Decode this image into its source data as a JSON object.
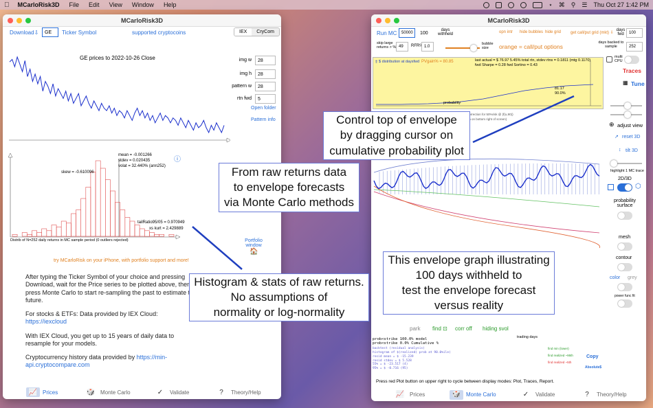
{
  "menubar": {
    "app": "MCarloRisk3D",
    "items": [
      "File",
      "Edit",
      "View",
      "Window",
      "Help"
    ],
    "clock": "Thu Oct 27  1:42 PM"
  },
  "left": {
    "title": "MCarloRisk3D",
    "download": "Download⇩",
    "ticker_value": "GE",
    "ticker_label": "Ticker Symbol",
    "supported": "supported cryptocoins",
    "seg": [
      "IEX",
      "CryCom"
    ],
    "chart_title": "GE prices to 2022-10-26 Close",
    "params": [
      {
        "label": "img w",
        "value": "28"
      },
      {
        "label": "img h",
        "value": "28"
      },
      {
        "label": "pattern w",
        "value": "28"
      },
      {
        "label": "rtn fwd",
        "value": "5"
      }
    ],
    "open_folder": "Open folder",
    "pattern_info": "Pattern info",
    "stats": {
      "mean": "mean = -0.001266",
      "stdev": "stdev = 0.020435",
      "volat": "volat = 32.440% (ann252)",
      "skew": "skew = -0.610096",
      "tail": "tailRatio95/05 = 0.970949",
      "kurt": "xs kurt = 2.429889"
    },
    "hist_caption": "Distrib of N=252 daily  returns in MC sample period (0 outliers rejected)",
    "portfolio": "Portfolio window",
    "promo": "try MCarloRisk on your iPhone, with portfolio support and more!",
    "para1": "After typing the Ticker Symbol of your choice and pressing Download, wait for the Price series to be plotted above, then press Monte Carlo to start re-sampling the past to estimate the future.",
    "para2a": "For stocks & ETFs:  Data provided by IEX Cloud:  ",
    "para2b": "https://iexcloud",
    "para3": "With IEX Cloud, you get up to 15 years of daily data to resample for your models.",
    "para4a": "Cryptocurrency history data provided by ",
    "para4b": "https://min-api.cryptocompare.com",
    "tabs": [
      "Prices",
      "Monte Carlo",
      "Validate",
      "Theory/Help"
    ]
  },
  "right": {
    "title": "MCarloRisk3D",
    "run_mc": "Run MC",
    "runs": "50000",
    "days_withheld_val": "100",
    "days_withheld": "days withheld",
    "links": [
      "opn intr",
      "hide bubbles",
      "hide grid",
      "get call/put grid (mkt) ⇩"
    ],
    "days_fwd_label": "days fwd",
    "days_fwd_val": "100",
    "skip_label": "skip large returns > %",
    "skip_val": "49",
    "rfr_label": "RFR%",
    "rfr_val": "1.0",
    "bubble": "bubble size",
    "callput": "orange = call/put options",
    "backed_label": "days backed to sample",
    "backed_val": "252",
    "prob_title": "$ distribution at daysfwd",
    "pvgain": "PVgain% = 80.85",
    "actual": "last actual = $ 76.97   5.45% total rtn, stdev rtns = 0.1811 (mtg 0.1170)",
    "sharpe": "fwd Sharpe = 0.28 fwd Sortino = 0.43",
    "prob_axis": "probability",
    "cursor_val": "81.17",
    "cursor_pct": "90.0%",
    "corr_text": "correction for 50%risk @ (f(u,90))",
    "corr_text2": "ch on bottom right of screen)",
    "multi_cpu": "multi CPU",
    "traces": "Traces",
    "tune": "Tune",
    "adjust_view": "adjust view",
    "reset3d": "reset 3D",
    "tilt3d": "tilt 3D",
    "highlight": "highlight 1 MC trace",
    "mode2d3d": "2D/3D",
    "prob_surface": "probability surface",
    "mesh": "mesh",
    "contour": "contour",
    "color": "color",
    "grey": "grey",
    "power": "power func fit",
    "bottom_links": [
      "park",
      "find ⊡",
      "corr off",
      "hiding svol"
    ],
    "prob_strike1": "prob<strike 100.0%  model",
    "prob_strike2": "prob<strike   0.0%  Cumulative %",
    "trading_days": "trading days",
    "backtest_lines": [
      "backtest (residual analysis)",
      "histogram of $(realized) prob at 90.0%ile)",
      "resid mean  = $  -15.239",
      "resid stdev = $   5.528",
      "  55% = $  -23.517 (4)",
      "  95% = $   -0.716 (95)"
    ],
    "green_labels": [
      "find min (lower)",
      "find realized ~95th",
      "find realized ~5th"
    ],
    "copy": "Copy",
    "absolute": "Absolute$",
    "footer_note": "Press red Plot button on upper right to cycle between display modes:  Plot, Traces, Report.",
    "tabs": [
      "Prices",
      "Monte Carlo",
      "Validate",
      "Theory/Help"
    ]
  },
  "callouts": {
    "c1": [
      "From raw returns data",
      "to envelope forecasts",
      "via Monte Carlo methods"
    ],
    "c2": [
      "Control top of envelope",
      "by dragging cursor on",
      "cumulative probability plot"
    ],
    "c3": [
      "Histogram & stats of raw returns.",
      "No assumptions of",
      "normality or log-normality"
    ],
    "c4": [
      "This envelope graph illustrating",
      "100 days withheld to",
      "test the envelope forecast",
      "versus reality"
    ]
  },
  "colors": {
    "accent": "#2a6fd8",
    "prob_bg": "#fdf5a0",
    "orange": "#e08020",
    "red_btn": "#e03030",
    "arrow": "#1f3fbf"
  },
  "chart_data": [
    {
      "type": "line",
      "title": "GE prices to 2022-10-26 Close",
      "series": [
        {
          "values": [
            70,
            72,
            66,
            74,
            68,
            62,
            71,
            58,
            64,
            54,
            60,
            52,
            58,
            46,
            54,
            50,
            44,
            52,
            42,
            48,
            44,
            40,
            46,
            38,
            44,
            36,
            40,
            44,
            34,
            38,
            42,
            36,
            32,
            38,
            34,
            30,
            36,
            32,
            30,
            34,
            28,
            32,
            26,
            30,
            28,
            24,
            30,
            26,
            22,
            28,
            32,
            26,
            30,
            24,
            28,
            22,
            26,
            20,
            24,
            28,
            22,
            26,
            24,
            20,
            24,
            22,
            18,
            24,
            20,
            16,
            22,
            18,
            14,
            20,
            16,
            18,
            22,
            16,
            12,
            18,
            14,
            20,
            16,
            12,
            18
          ]
        }
      ]
    },
    {
      "type": "bar",
      "title": "Distrib of N=252 daily  returns in MC sample period (0 outliers rejected)",
      "values": [
        1,
        0,
        2,
        1,
        3,
        2,
        4,
        3,
        6,
        5,
        8,
        7,
        12,
        14,
        20,
        26,
        34,
        40,
        36,
        30,
        24,
        18,
        14,
        10,
        8,
        6,
        4,
        3,
        2,
        1,
        1,
        0,
        1
      ]
    }
  ]
}
